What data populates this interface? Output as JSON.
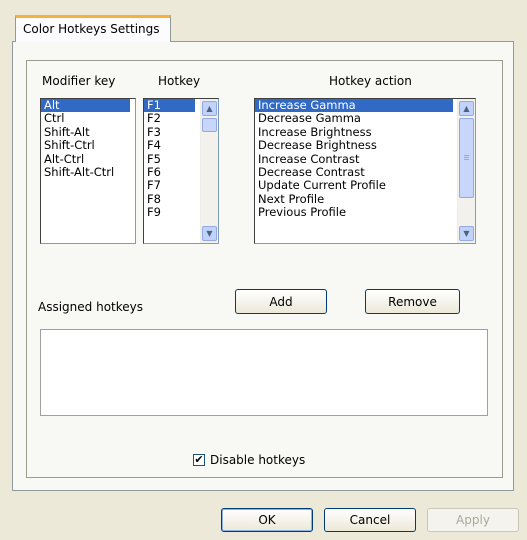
{
  "tab": {
    "title": "Color Hotkeys Settings"
  },
  "headers": {
    "modifier": "Modifier key",
    "hotkey": "Hotkey",
    "action": "Hotkey action"
  },
  "modifier_keys": [
    "Alt",
    "Ctrl",
    "Shift-Alt",
    "Shift-Ctrl",
    "Alt-Ctrl",
    "Shift-Alt-Ctrl"
  ],
  "hotkeys": [
    "F1",
    "F2",
    "F3",
    "F4",
    "F5",
    "F6",
    "F7",
    "F8",
    "F9"
  ],
  "actions": [
    "Increase Gamma",
    "Decrease Gamma",
    "Increase Brightness",
    "Decrease Brightness",
    "Increase Contrast",
    "Decrease Contrast",
    "Update Current Profile",
    "Next Profile",
    "Previous Profile"
  ],
  "assigned": {
    "label": "Assigned hotkeys"
  },
  "buttons": {
    "add": "Add",
    "remove": "Remove",
    "ok": "OK",
    "cancel": "Cancel",
    "apply": "Apply"
  },
  "disable": {
    "label": "Disable hotkeys",
    "checked": true
  },
  "colors": {
    "selection": "#316ac5",
    "tab_accent": "#f5b13d",
    "background": "#ece9d8"
  }
}
